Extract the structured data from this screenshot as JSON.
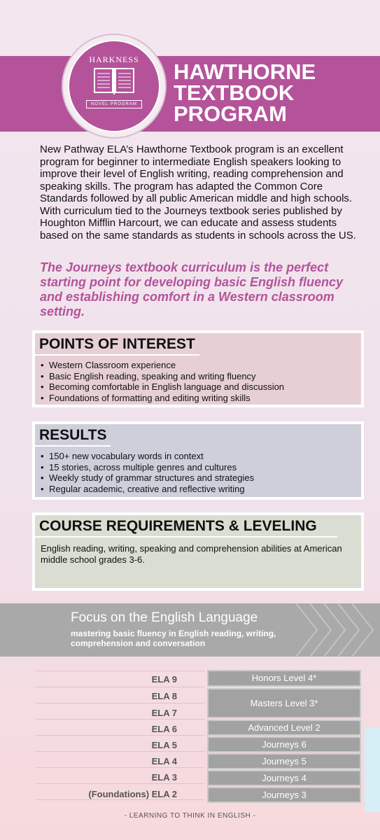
{
  "header": {
    "title_lines": [
      "HAWTHORNE",
      "TEXTBOOK",
      "PROGRAM"
    ],
    "logo_name": "HARKNESS",
    "logo_sub": "NOVEL PROGRAM"
  },
  "intro": {
    "paragraph": "New Pathway ELA’s Hawthorne Textbook program is an excellent program for beginner to intermediate English speakers looking to improve their level of English writing, reading comprehension and speaking skills. The program has adapted the Common Core Standards followed by all public American middle and high schools. With curriculum tied to the Journeys textbook series published by Houghton Mifflin Harcourt, we can educate and assess students based on the same standards as students in schools across the US.",
    "tagline": "The Journeys textbook curriculum is the perfect starting point for developing basic English fluency and establishing comfort in a Western classroom setting."
  },
  "points": {
    "heading": "POINTS OF INTEREST",
    "items": [
      "Western Classroom experience",
      "Basic English reading, speaking and writing fluency",
      "Becoming comfortable in English language and discussion",
      "Foundations of formatting and editing writing skills"
    ]
  },
  "results": {
    "heading": "RESULTS",
    "items": [
      "150+ new vocabulary words in context",
      "15 stories, across multiple genres and cultures",
      "Weekly study of grammar structures and strategies",
      "Regular academic, creative and reflective writing"
    ]
  },
  "requirements": {
    "heading": "COURSE REQUIREMENTS & LEVELING",
    "text": "English reading, writing, speaking and comprehension abilities at American middle school grades 3-6."
  },
  "focus": {
    "title": "Focus on the English Language",
    "subtitle": "mastering basic fluency in English reading, writing, comprehension and conversation"
  },
  "levels": {
    "ela_labels": [
      "ELA 9",
      "ELA 8",
      "ELA 7",
      "ELA 6",
      "ELA 5",
      "ELA 4",
      "ELA 3",
      "(Foundations) ELA 2"
    ],
    "boxes": [
      "Honors Level 4*",
      "Masters Level 3*",
      "Advanced Level 2",
      "Journeys 6",
      "Journeys 5",
      "Journeys 4",
      "Journeys 3"
    ]
  },
  "footer": "- LEARNING TO THINK IN ENGLISH -",
  "colors": {
    "accent": "#b4539a",
    "banner_gray": "#a9a9a9"
  }
}
